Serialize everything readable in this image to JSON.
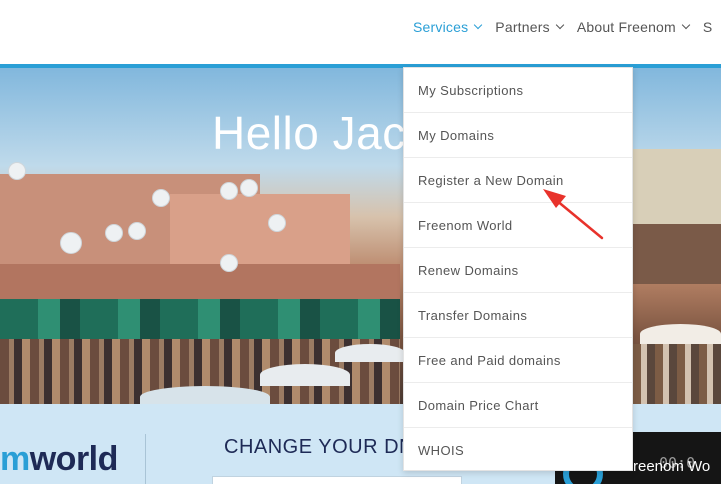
{
  "nav": {
    "items": [
      {
        "label": "Services",
        "active": true
      },
      {
        "label": "Partners",
        "active": false
      },
      {
        "label": "About Freenom",
        "active": false
      }
    ],
    "overflow_label": "S"
  },
  "hero": {
    "title": "Hello Jac"
  },
  "dropdown": {
    "items": [
      "My Subscriptions",
      "My Domains",
      "Register a New Domain",
      "Freenom World",
      "Renew Domains",
      "Transfer Domains",
      "Free and Paid domains",
      "Domain Price Chart",
      "WHOIS"
    ]
  },
  "band": {
    "logo_prefix": "m",
    "logo_suffix": "world",
    "heading": "CHANGE YOUR DN",
    "video_title": "reenom Wo",
    "video_time": "00:0"
  },
  "annotation": {
    "arrow_color": "#e8322b",
    "target": "Register a New Domain"
  },
  "colors": {
    "accent": "#2a9fd6",
    "text": "#555555",
    "navy": "#1e2a56",
    "band": "#cfe6f5"
  }
}
